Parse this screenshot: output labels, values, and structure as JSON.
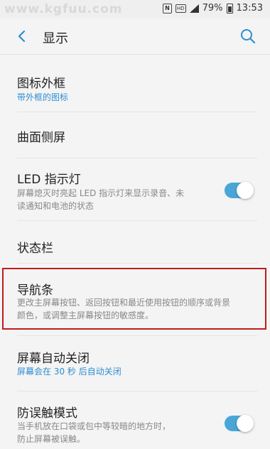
{
  "status_bar": {
    "watermark": "www.kgfuu.com",
    "battery_percent": "79%",
    "time": "13:53",
    "icons": [
      "nfc-icon",
      "hd-icon",
      "signal-icon",
      "battery-icon"
    ]
  },
  "header": {
    "title": "显示",
    "back_icon": "chevron-left-icon",
    "search_icon": "search-icon"
  },
  "settings": {
    "icon_frame": {
      "title": "图标外框",
      "value": "带外框的图标"
    },
    "edge_screen": {
      "title": "曲面侧屏"
    },
    "led": {
      "title": "LED 指示灯",
      "desc_line1": "屏幕熄灭时亮起 LED 指示灯来显示录音、未",
      "desc_line2": "读通知和电池的状态",
      "enabled": true
    },
    "status_bar_item": {
      "title": "状态栏"
    },
    "nav_bar": {
      "title": "导航条",
      "desc_line1": "更改主屏幕按钮、返回按钮和最近使用按钮的顺序或背景",
      "desc_line2": "颜色，或调整主屏幕按钮的敏感度。"
    },
    "screen_timeout": {
      "title": "屏幕自动关闭",
      "value": "屏幕会在 30 秒 后自动关闭"
    },
    "accidental_touch": {
      "title": "防误触模式",
      "desc_line1": "当手机放在口袋或包中等较暗的地方时，",
      "desc_line2": "防止屏幕被误触。",
      "enabled": true
    }
  },
  "colors": {
    "accent": "#2d8ed1",
    "toggle_on": "#4aa6d6",
    "highlight_border": "#c21a1a"
  }
}
